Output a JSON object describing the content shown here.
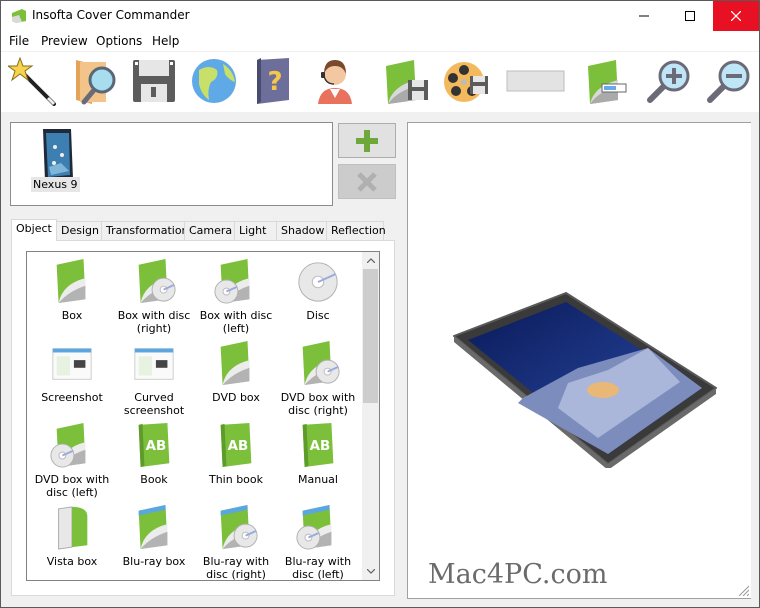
{
  "window": {
    "title": "Insofta Cover Commander",
    "controls": {
      "minimize": "minimize",
      "maximize": "maximize",
      "close": "close"
    },
    "close_color": "#e81123"
  },
  "menu": [
    "File",
    "Preview",
    "Options",
    "Help"
  ],
  "toolbar": [
    {
      "name": "wizard",
      "icon": "magic-wand-icon"
    },
    {
      "name": "open",
      "icon": "folder-search-icon"
    },
    {
      "name": "save",
      "icon": "floppy-disk-icon"
    },
    {
      "name": "web",
      "icon": "globe-icon"
    },
    {
      "name": "help",
      "icon": "help-book-icon"
    },
    {
      "name": "support",
      "icon": "support-agent-icon"
    },
    {
      "name": "save-image",
      "icon": "box-save-icon"
    },
    {
      "name": "save-video",
      "icon": "film-reel-save-icon"
    },
    {
      "name": "blank",
      "icon": "gray-rectangle-icon"
    },
    {
      "name": "batch-render",
      "icon": "box-progress-icon"
    },
    {
      "name": "zoom-in",
      "icon": "zoom-in-icon"
    },
    {
      "name": "zoom-out",
      "icon": "zoom-out-icon"
    }
  ],
  "objects": {
    "items": [
      {
        "label": "Nexus 9",
        "selected": true
      }
    ],
    "add_button": "add",
    "remove_button": "remove",
    "accent": "#6ea83a"
  },
  "tabs": [
    "Object",
    "Design",
    "Transformation",
    "Camera",
    "Light",
    "Shadow",
    "Reflection"
  ],
  "active_tab": "Object",
  "gallery": [
    {
      "label": "Box",
      "kind": "box"
    },
    {
      "label": "Box with disc (right)",
      "kind": "box-disc-right"
    },
    {
      "label": "Box with disc (left)",
      "kind": "box-disc-left"
    },
    {
      "label": "Disc",
      "kind": "disc"
    },
    {
      "label": "Screenshot",
      "kind": "screenshot"
    },
    {
      "label": "Curved screenshot",
      "kind": "curved-screenshot"
    },
    {
      "label": "DVD box",
      "kind": "dvd"
    },
    {
      "label": "DVD box with disc (right)",
      "kind": "dvd-disc-right"
    },
    {
      "label": "DVD box with disc (left)",
      "kind": "dvd-disc-left"
    },
    {
      "label": "Book",
      "kind": "book"
    },
    {
      "label": "Thin book",
      "kind": "thin-book"
    },
    {
      "label": "Manual",
      "kind": "manual"
    },
    {
      "label": "Vista box",
      "kind": "vista"
    },
    {
      "label": "Blu-ray box",
      "kind": "bluray"
    },
    {
      "label": "Blu-ray with disc (right)",
      "kind": "bluray-disc-right"
    },
    {
      "label": "Blu-ray with disc (left)",
      "kind": "bluray-disc-left"
    }
  ],
  "preview": {
    "watermark": "Mac4PC.com",
    "object": "Nexus 9 tablet"
  }
}
